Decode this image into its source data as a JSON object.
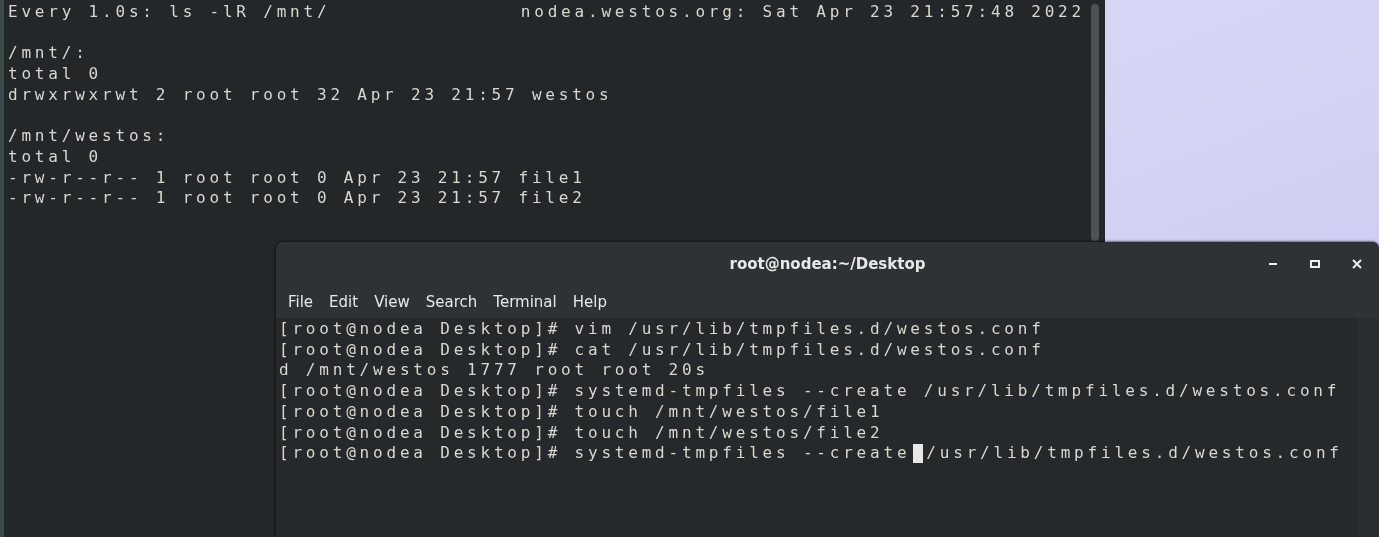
{
  "back_terminal": {
    "header_left": "Every 1.0s: ls -lR /mnt/",
    "header_right": "nodea.westos.org: Sat Apr 23 21:57:48 2022",
    "sections": [
      {
        "lines": [
          "/mnt/:",
          "total 0",
          "drwxrwxrwt 2 root root 32 Apr 23 21:57 westos"
        ]
      },
      {
        "lines": [
          "/mnt/westos:",
          "total 0",
          "-rw-r--r-- 1 root root 0 Apr 23 21:57 file1",
          "-rw-r--r-- 1 root root 0 Apr 23 21:57 file2"
        ]
      }
    ]
  },
  "front_terminal": {
    "title": "root@nodea:~/Desktop",
    "menu": [
      "File",
      "Edit",
      "View",
      "Search",
      "Terminal",
      "Help"
    ],
    "lines": [
      "[root@nodea Desktop]# vim /usr/lib/tmpfiles.d/westos.conf",
      "[root@nodea Desktop]# cat /usr/lib/tmpfiles.d/westos.conf",
      "d /mnt/westos 1777 root root 20s",
      "[root@nodea Desktop]# systemd-tmpfiles --create /usr/lib/tmpfiles.d/westos.conf",
      "[root@nodea Desktop]# touch /mnt/westos/file1",
      "[root@nodea Desktop]# touch /mnt/westos/file2"
    ],
    "input_line": {
      "before_cursor": "[root@nodea Desktop]# systemd-tmpfiles --create",
      "after_cursor": "/usr/lib/tmpfiles.d/westos.conf"
    }
  }
}
